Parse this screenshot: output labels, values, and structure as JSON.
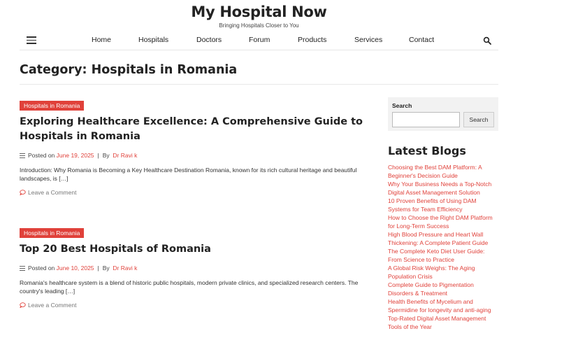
{
  "site": {
    "title": "My Hospital Now",
    "tagline": "Bringing Hospitals Closer to You"
  },
  "nav": {
    "items": [
      {
        "label": "Home"
      },
      {
        "label": "Hospitals"
      },
      {
        "label": "Doctors"
      },
      {
        "label": "Forum"
      },
      {
        "label": "Products"
      },
      {
        "label": "Services"
      },
      {
        "label": "Contact"
      }
    ],
    "menu_icon": "hamburger-icon",
    "search_icon": "search-icon"
  },
  "page": {
    "title": "Category: Hospitals in Romania"
  },
  "posts": [
    {
      "category": "Hospitals in Romania",
      "title": "Exploring Healthcare Excellence: A Comprehensive Guide to Hospitals in Romania",
      "posted_prefix": "Posted on",
      "date": "June 19, 2025",
      "by_label": "By",
      "author": "Dr Ravi k",
      "excerpt": "Introduction: Why Romania is Becoming a Key Healthcare Destination Romania, known for its rich cultural heritage and beautiful landscapes, is […]",
      "comment_label": "Leave a Comment"
    },
    {
      "category": "Hospitals in Romania",
      "title": "Top 20 Best Hospitals of Romania",
      "posted_prefix": "Posted on",
      "date": "June 10, 2025",
      "by_label": "By",
      "author": "Dr Ravi k",
      "excerpt": "Romania's healthcare system is a blend of historic public hospitals, modern private clinics, and specialized research centers. The country's leading […]",
      "comment_label": "Leave a Comment"
    }
  ],
  "sidebar": {
    "search_label": "Search",
    "search_value": "",
    "search_button": "Search",
    "latest_title": "Latest Blogs",
    "latest": [
      "Choosing the Best DAM Platform: A Beginner's Decision Guide",
      "Why Your Business Needs a Top-Notch Digital Asset Management Solution",
      "10 Proven Benefits of Using DAM Systems for Team Efficiency",
      "How to Choose the Right DAM Platform for Long-Term Success",
      "High Blood Pressure and Heart Wall Thickening: A Complete Patient Guide",
      "The Complete Keto Diet User Guide: From Science to Practice",
      "A Global Risk Weighs: The Aging Population Crisis",
      "Complete Guide to Pigmentation Disorders & Treatment",
      "Health Benefits of Mycelium and Spermidine for longevity and anti-aging",
      "Top-Rated Digital Asset Management Tools of the Year"
    ]
  },
  "colors": {
    "accent": "#e0413a",
    "text": "#222222"
  }
}
